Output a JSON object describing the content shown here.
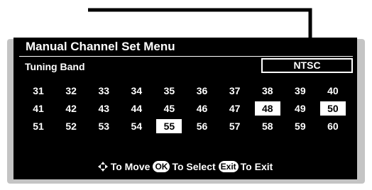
{
  "menu": {
    "title": "Manual Channel Set Menu",
    "band_label": "Tuning Band",
    "band_value": "NTSC"
  },
  "channels": [
    [
      "31",
      "32",
      "33",
      "34",
      "35",
      "36",
      "37",
      "38",
      "39",
      "40"
    ],
    [
      "41",
      "42",
      "43",
      "44",
      "45",
      "46",
      "47",
      "48",
      "49",
      "50"
    ],
    [
      "51",
      "52",
      "53",
      "54",
      "55",
      "56",
      "57",
      "58",
      "59",
      "60"
    ]
  ],
  "highlighted_channels": [
    "48",
    "50",
    "55"
  ],
  "legend": {
    "move_icon": "four-way-arrow-icon",
    "move_label": "To Move",
    "ok_key": "OK",
    "select_label": "To Select",
    "exit_key": "Exit",
    "exit_label": "To Exit"
  },
  "colors": {
    "panel": "#000000",
    "frame": "#c4c4c4",
    "text": "#ffffff",
    "highlight": "#ffffff"
  }
}
